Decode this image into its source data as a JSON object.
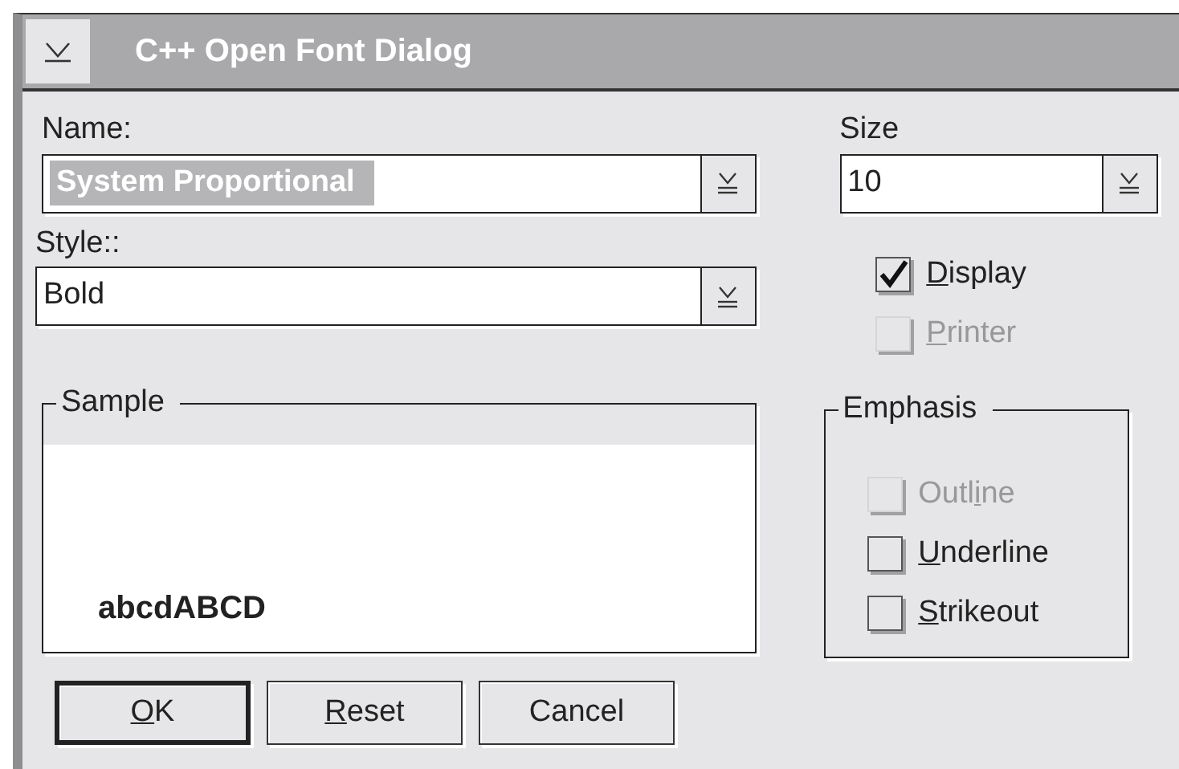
{
  "window": {
    "title": "C++ Open Font Dialog"
  },
  "name_field": {
    "label": "Name:",
    "value": "System Proportional",
    "selected": true
  },
  "size_field": {
    "label": "Size",
    "value": "10"
  },
  "style_field": {
    "label": "Style::",
    "value": "Bold"
  },
  "devices": [
    {
      "label": {
        "key": "D",
        "post": "isplay"
      },
      "checked": true,
      "disabled": false
    },
    {
      "label": {
        "key": "P",
        "post": "rinter"
      },
      "checked": false,
      "disabled": true
    }
  ],
  "sample": {
    "title": "Sample",
    "text": "abcdABCD"
  },
  "emphasis": {
    "title": "Emphasis",
    "options": [
      {
        "label": {
          "pre": "Outl",
          "key": "i",
          "post": "ne"
        },
        "checked": false,
        "disabled": true
      },
      {
        "label": {
          "key": "U",
          "post": "nderline"
        },
        "checked": false,
        "disabled": false
      },
      {
        "label": {
          "key": "S",
          "post": "trikeout"
        },
        "checked": false,
        "disabled": false
      }
    ]
  },
  "buttons": [
    {
      "label": {
        "key": "O",
        "post": "K"
      },
      "default": true
    },
    {
      "label": {
        "key": "R",
        "post": "eset"
      },
      "default": false
    },
    {
      "label": {
        "pre": "Cancel"
      },
      "default": false
    }
  ]
}
